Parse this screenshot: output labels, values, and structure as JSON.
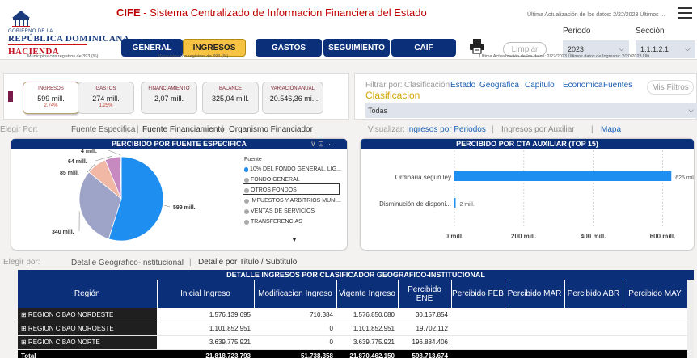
{
  "header": {
    "brand_short": "CIFE",
    "title_rest": " - Sistema Centralizado de Informacion Financiera del Estado",
    "last_update_top": "Última Actualización de los datos: 2/22/2023 Últimos ...",
    "logo": {
      "line1": "GOBIERNO DE LA",
      "line2": "REPÚBLICA DOMINICANA",
      "line3": "HACIENDA"
    }
  },
  "nav": {
    "items": [
      {
        "label": "GENERAL",
        "active": false
      },
      {
        "label": "INGRESOS",
        "active": true
      },
      {
        "label": "GASTOS",
        "active": false
      },
      {
        "label": "SEGUIMIENTO",
        "active": false
      },
      {
        "label": "CAIF",
        "active": false
      }
    ],
    "limpiar_label": "Limpiar",
    "periodo_label": "Periodo",
    "periodo_value": "2023",
    "seccion_label": "Sección",
    "seccion_value": "1.1.1.2.1"
  },
  "subheader": {
    "left_note": "Municipios con registros de 393 (%)",
    "mid_note": "Municipios con registros de 393 (%)",
    "right_note": "Última Actualización de los datos: 2/22/2023 Últimos datos de Ingresos: 2/20/2023 Últi..."
  },
  "kpis": [
    {
      "label": "INGRESOS",
      "value": "599 mill.",
      "pct": "2,74%"
    },
    {
      "label": "GASTOS",
      "value": "274 mill.",
      "pct": "1,25%"
    },
    {
      "label": "FINANCIAMIENTO",
      "value": "2,07 mill.",
      "pct": ""
    },
    {
      "label": "BALANCE",
      "value": "325,04 mill.",
      "pct": ""
    },
    {
      "label": "VARIACIÓN ANUAL",
      "value": "-20.546,36 mi...",
      "pct": ""
    }
  ],
  "filters": {
    "filtrar_label": "Filtrar por:",
    "tabs": [
      "Clasificación",
      "Estado",
      "Geografica",
      "Capitulo",
      "Economica",
      "Fuentes"
    ],
    "mis_filtros": "Mis Filtros",
    "section_title": "Clasificacion",
    "selected": "Todas"
  },
  "elegir1": {
    "label": "Elegir Por:",
    "tabs": [
      "Fuente Especifica",
      "Fuente Financiamiento",
      "Organismo Financiador"
    ]
  },
  "visualizar": {
    "label": "Visualizar:",
    "tabs": [
      "Ingresos por Periodos",
      "Ingresos por Auxiliar",
      "Mapa"
    ]
  },
  "pie_panel": {
    "title": "PERCIBIDO POR FUENTE ESPECIFICA",
    "legend_title": "Fuente",
    "legend": [
      {
        "name": "10% DEL FONDO GENERAL, LIG...",
        "color": "#1f8ef1"
      },
      {
        "name": "FONDO GENERAL",
        "color": "#9ea4c8"
      },
      {
        "name": "OTROS FONDOS",
        "color": "#f2b8a6"
      },
      {
        "name": "IMPUESTOS Y ARBITRIOS MUNI...",
        "color": "#c78ac0"
      },
      {
        "name": "VENTAS DE SERVICIOS",
        "color": "#e6a7d8"
      },
      {
        "name": "TRANSFERENCIAS",
        "color": "#b6b6b6"
      }
    ]
  },
  "bar_panel": {
    "title": "PERCIBIDO POR CTA AUXILIAR (TOP 15)"
  },
  "chart_data": [
    {
      "type": "pie",
      "title": "PERCIBIDO POR FUENTE ESPECIFICA",
      "slices": [
        {
          "name": "10% DEL FONDO GENERAL, LIG...",
          "value": 599,
          "label": "599 mill."
        },
        {
          "name": "FONDO GENERAL",
          "value": 340,
          "label": "340 mill."
        },
        {
          "name": "OTROS FONDOS",
          "value": 85,
          "label": "85 mill."
        },
        {
          "name": "IMPUESTOS Y ARBITRIOS MUNI...",
          "value": 64,
          "label": "64 mill."
        },
        {
          "name": "VENTAS DE SERVICIOS",
          "value": 4,
          "label": "4 mill."
        }
      ]
    },
    {
      "type": "bar",
      "orientation": "horizontal",
      "title": "PERCIBIDO POR CTA AUXILIAR (TOP 15)",
      "categories": [
        "Ordinaria según ley",
        "Disminución de disponi..."
      ],
      "values": [
        625,
        2
      ],
      "value_labels": [
        "625 mill.",
        "2 mill."
      ],
      "xlim": [
        0,
        650
      ],
      "xticks": [
        0,
        200,
        400,
        600
      ],
      "xtick_labels": [
        "0 mill.",
        "200 mill.",
        "400 mill.",
        "600 mill."
      ]
    }
  ],
  "elegir2": {
    "label": "Elegir por:",
    "tabs": [
      "Detalle Geografico-Institucional",
      "Detalle por Titulo / Subtitulo"
    ]
  },
  "table": {
    "title": "DETALLE INGRESOS POR CLASIFICADOR GEOGRAFICO-INSTITUCIONAL",
    "columns": [
      "Región",
      "Inicial Ingreso",
      "Modificacion Ingreso",
      "Vigente Ingreso",
      "Percibido ENE",
      "Percibido FEB",
      "Percibido MAR",
      "Percibido ABR",
      "Percibido MAY"
    ],
    "rows": [
      [
        "REGION CIBAO NORDESTE",
        "1.576.139.695",
        "710.384",
        "1.576.850.080",
        "30.157.854",
        "",
        "",
        "",
        ""
      ],
      [
        "REGION CIBAO NOROESTE",
        "1.101.852.951",
        "0",
        "1.101.852.951",
        "19.702.112",
        "",
        "",
        "",
        ""
      ],
      [
        "REGION CIBAO NORTE",
        "3.639.775.921",
        "0",
        "3.639.775.921",
        "196.884.406",
        "",
        "",
        "",
        ""
      ]
    ],
    "total": [
      "Total",
      "21.818.723.793",
      "51.738.358",
      "21.870.462.150",
      "598.713.674",
      "",
      "",
      "",
      ""
    ]
  },
  "colors": {
    "navy": "#0c2f7a",
    "gold": "#f6c342",
    "brand_red": "#c00000"
  }
}
